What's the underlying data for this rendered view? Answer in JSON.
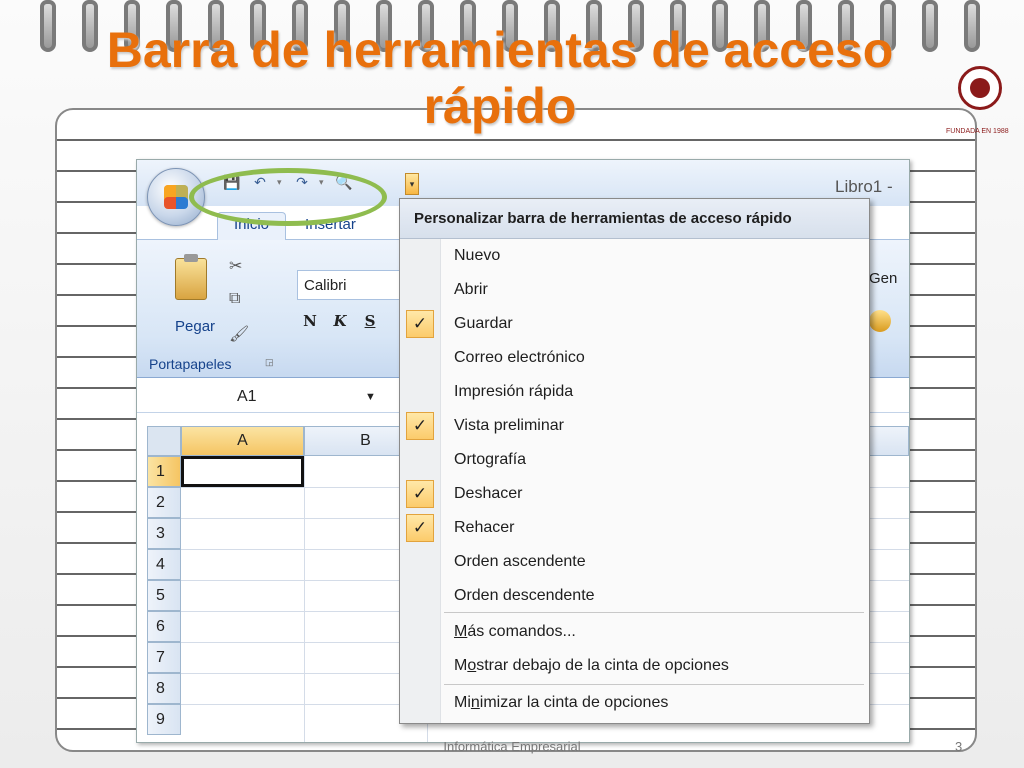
{
  "slide": {
    "title_line1": "Barra de herramientas de acceso",
    "title_line2": "rápido",
    "seal_caption": "FUNDADA EN 1988",
    "footer_text": "Informática Empresarial",
    "page_number": "3"
  },
  "window": {
    "title": "Libro1 -",
    "qat": [
      "save-icon",
      "undo-icon",
      "redo-icon",
      "print-preview-icon"
    ],
    "tabs": [
      "Inicio",
      "Insertar"
    ],
    "active_tab": "Inicio"
  },
  "ribbon": {
    "paste_label": "Pegar",
    "clipboard_group": "Portapapeles",
    "font_name": "Calibri",
    "font_buttons": [
      "N",
      "K",
      "S"
    ],
    "number_format_partial": "Gen"
  },
  "sheet": {
    "name_box": "A1",
    "columns": [
      "A",
      "B"
    ],
    "rows": [
      "1",
      "2",
      "3",
      "4",
      "5",
      "6",
      "7",
      "8",
      "9"
    ],
    "active_cell": "A1"
  },
  "menu": {
    "header": "Personalizar barra de herramientas de acceso rápido",
    "check_glyph": "✓",
    "items": [
      {
        "label": "Nuevo",
        "checked": false
      },
      {
        "label": "Abrir",
        "checked": false
      },
      {
        "label": "Guardar",
        "checked": true
      },
      {
        "label": "Correo electrónico",
        "checked": false
      },
      {
        "label": "Impresión rápida",
        "checked": false
      },
      {
        "label": "Vista preliminar",
        "checked": true
      },
      {
        "label": "Ortografía",
        "checked": false
      },
      {
        "label": "Deshacer",
        "checked": true
      },
      {
        "label": "Rehacer",
        "checked": true
      },
      {
        "label": "Orden ascendente",
        "checked": false
      },
      {
        "label": "Orden descendente",
        "checked": false
      }
    ],
    "more_commands": {
      "pre": "",
      "u": "M",
      "post": "ás comandos..."
    },
    "show_below": {
      "pre": "M",
      "u": "o",
      "post": "strar debajo de la cinta de opciones"
    },
    "minimize": {
      "pre": "Mi",
      "u": "n",
      "post": "imizar la cinta de opciones"
    }
  }
}
